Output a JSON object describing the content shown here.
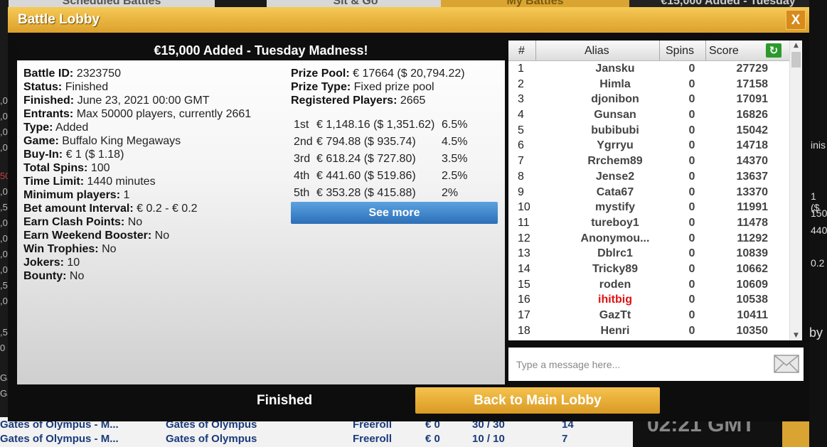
{
  "background": {
    "tabs": [
      "Scheduled Battles",
      "Sit & Go",
      "My Battles",
      "€15,000 Added - Tuesday"
    ],
    "right_fragments": [
      "inis",
      "1 ($",
      "150",
      "440",
      "0.2",
      "by"
    ],
    "left_fragments": [
      ",0",
      ",0",
      ",0",
      ",0",
      "50",
      ",0",
      ",5",
      ",0",
      ",0",
      ",0",
      ",0",
      ",5",
      ",0",
      ",5",
      "0",
      "Ga",
      "Ga"
    ],
    "rows": [
      {
        "name": "Gates of Olympus - M...",
        "game": "Gates of Olympus",
        "type": "Freeroll",
        "buyin": "€ 0",
        "players": "30 / 30",
        "extra": "14"
      },
      {
        "name": "Gates of Olympus - M...",
        "game": "Gates of Olympus",
        "type": "Freeroll",
        "buyin": "€ 0",
        "players": "10 / 10",
        "extra": "7"
      }
    ],
    "clock_fragment": "02:21 GMT"
  },
  "modal": {
    "title": "Battle Lobby",
    "close_label": "X",
    "header": "€15,000 Added - Tuesday Madness!",
    "details": [
      {
        "label": "Battle ID:",
        "value": "2323750"
      },
      {
        "label": "Status:",
        "value": "Finished"
      },
      {
        "label": "Finished:",
        "value": "June 23, 2021 00:00 GMT"
      },
      {
        "label": "Entrants:",
        "value": "Max 50000 players, currently 2661"
      },
      {
        "label": "Type:",
        "value": "Added"
      },
      {
        "label": "Game:",
        "value": "Buffalo King Megaways"
      },
      {
        "label": "Buy-In:",
        "value": "€ 1 ($ 1.18)"
      },
      {
        "label": "Total Spins:",
        "value": "100"
      },
      {
        "label": "Time Limit:",
        "value": "1440 minutes"
      },
      {
        "label": "Minimum players:",
        "value": "1"
      },
      {
        "label": "Bet amount Interval:",
        "value": "€ 0.2 - € 0.2"
      },
      {
        "label": "Earn Clash Points:",
        "value": "No"
      },
      {
        "label": "Earn Weekend Booster:",
        "value": "No"
      },
      {
        "label": "Win Trophies:",
        "value": "No"
      },
      {
        "label": "Jokers:",
        "value": "10"
      },
      {
        "label": "Bounty:",
        "value": "No"
      }
    ],
    "prize": [
      {
        "label": "Prize Pool:",
        "value": "€ 17664 ($ 20,794.22)"
      },
      {
        "label": "Prize Type:",
        "value": "Fixed prize pool"
      },
      {
        "label": "Registered Players:",
        "value": "2665"
      }
    ],
    "prizes": [
      {
        "place": "1st",
        "amount": "€ 1,148.16 ($ 1,351.62)",
        "pct": "6.5%"
      },
      {
        "place": "2nd",
        "amount": "€ 794.88 ($ 935.74)",
        "pct": "4.5%"
      },
      {
        "place": "3rd",
        "amount": "€ 618.24 ($ 727.80)",
        "pct": "3.5%"
      },
      {
        "place": "4th",
        "amount": "€ 441.60 ($ 519.86)",
        "pct": "2.5%"
      },
      {
        "place": "5th",
        "amount": "€ 353.28 ($ 415.88)",
        "pct": "2%"
      }
    ],
    "see_more_label": "See more",
    "leaderboard": {
      "columns": [
        "#",
        "Alias",
        "Spins",
        "Score"
      ],
      "rows": [
        {
          "rank": "1",
          "alias": "Jansku",
          "spins": "0",
          "score": "27729"
        },
        {
          "rank": "2",
          "alias": "Himla",
          "spins": "0",
          "score": "17158"
        },
        {
          "rank": "3",
          "alias": "djonibon",
          "spins": "0",
          "score": "17091"
        },
        {
          "rank": "4",
          "alias": "Gunsan",
          "spins": "0",
          "score": "16826"
        },
        {
          "rank": "5",
          "alias": "bubibubi",
          "spins": "0",
          "score": "15042"
        },
        {
          "rank": "6",
          "alias": "Ygrryu",
          "spins": "0",
          "score": "14718"
        },
        {
          "rank": "7",
          "alias": "Rrchem89",
          "spins": "0",
          "score": "14370"
        },
        {
          "rank": "8",
          "alias": "Jense2",
          "spins": "0",
          "score": "13637"
        },
        {
          "rank": "9",
          "alias": "Cata67",
          "spins": "0",
          "score": "13370"
        },
        {
          "rank": "10",
          "alias": "mystify",
          "spins": "0",
          "score": "11991"
        },
        {
          "rank": "11",
          "alias": "tureboy1",
          "spins": "0",
          "score": "11478"
        },
        {
          "rank": "12",
          "alias": "Anonymou...",
          "spins": "0",
          "score": "11292"
        },
        {
          "rank": "13",
          "alias": "Dblrc1",
          "spins": "0",
          "score": "10839"
        },
        {
          "rank": "14",
          "alias": "Tricky89",
          "spins": "0",
          "score": "10662"
        },
        {
          "rank": "15",
          "alias": "roden",
          "spins": "0",
          "score": "10609"
        },
        {
          "rank": "16",
          "alias": "ihitbig",
          "spins": "0",
          "score": "10538",
          "highlight": true
        },
        {
          "rank": "17",
          "alias": "GazTt",
          "spins": "0",
          "score": "10411"
        },
        {
          "rank": "18",
          "alias": "Henri",
          "spins": "0",
          "score": "10350"
        }
      ]
    },
    "chat_placeholder": "Type a message here...",
    "status_text": "Finished",
    "back_label": "Back to Main Lobby"
  },
  "colors": {
    "gold": "#dca02c",
    "highlight_red": "#e01010",
    "button_blue": "#2c6fb8",
    "refresh_green": "#2b9a2b"
  }
}
